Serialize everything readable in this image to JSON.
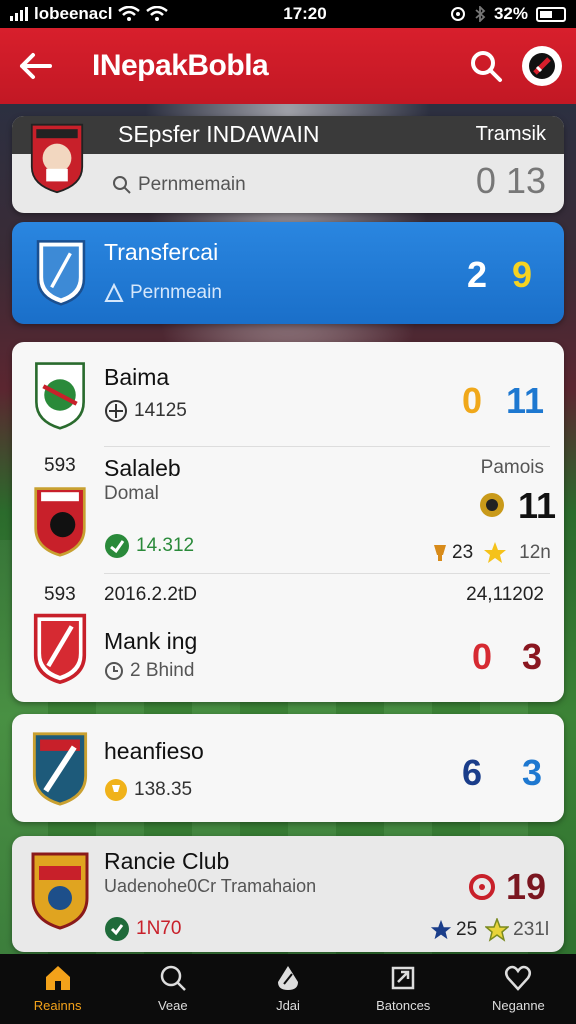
{
  "status_bar": {
    "carrier": "lobeenacl",
    "time": "17:20",
    "battery": "32%"
  },
  "app_bar": {
    "title": "INepakBobla"
  },
  "featured": {
    "header_title": "SEpsfer INDAWAIN",
    "header_right": "Tramsik",
    "subtitle": "Pernmemain",
    "score": "0 13"
  },
  "selected": {
    "name": "Transfercai",
    "subtitle": "Pernmeain",
    "score_a": "2",
    "score_b": "9"
  },
  "list_card": {
    "rows": [
      {
        "name": "Baima",
        "sub": "14125",
        "score_a": "0",
        "score_b": "11"
      },
      {
        "index": "593",
        "name": "Salaleb",
        "sub": "Domal",
        "right_label": "Pamois",
        "value": "14.312",
        "score_b": "11",
        "rating": "23",
        "extra": "12n"
      },
      {
        "index": "593",
        "date": "2016.2.2tD",
        "date_right": "24,11202",
        "name": "Mank ing",
        "sub": "2 Bhind",
        "score_a": "0",
        "score_b": "3"
      }
    ]
  },
  "card_4": {
    "name": "heanfieso",
    "sub": "138.35",
    "score_a": "6",
    "score_b": "3"
  },
  "card_5": {
    "name": "Rancie Club",
    "sub": "Uadenohe0Cr Tramahaion",
    "value": "1N70",
    "score_b": "19",
    "rating_a": "25",
    "rating_b": "231l"
  },
  "nav": [
    {
      "label": "Reainns",
      "icon": "home-icon"
    },
    {
      "label": "Veae",
      "icon": "search-icon"
    },
    {
      "label": "Jdai",
      "icon": "drop-icon"
    },
    {
      "label": "Batonces",
      "icon": "share-icon"
    },
    {
      "label": "Neganne",
      "icon": "heart-icon"
    }
  ],
  "colors": {
    "brand_red": "#d81f2c",
    "accent_blue": "#1e78d0",
    "active_nav": "#f3a21a"
  }
}
